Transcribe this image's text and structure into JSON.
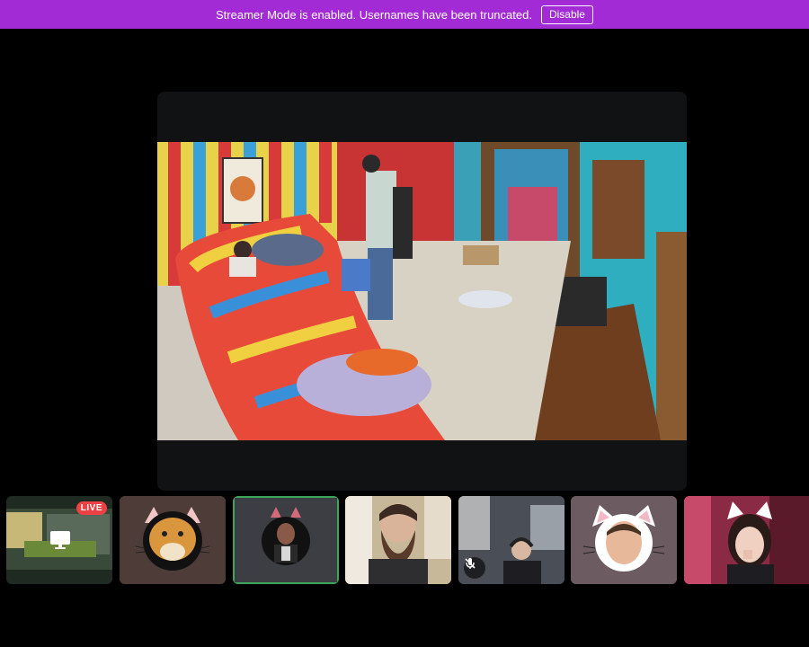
{
  "banner": {
    "message": "Streamer Mode is enabled. Usernames have been truncated.",
    "disable_label": "Disable",
    "bg_color": "#a32bd6"
  },
  "main_stream": {
    "type": "camera-feed",
    "frame_color": "#101214"
  },
  "participants": [
    {
      "kind": "screen-share",
      "badge": "LIVE",
      "badge_color": "#ed4245",
      "icon": "screen-share-icon"
    },
    {
      "kind": "camera",
      "filter": "dog-ears"
    },
    {
      "kind": "camera",
      "active": true,
      "highlight_color": "#3ba55c"
    },
    {
      "kind": "camera"
    },
    {
      "kind": "camera",
      "muted": true,
      "icon": "mic-muted-icon"
    },
    {
      "kind": "camera",
      "filter": "cat-ears"
    },
    {
      "kind": "camera",
      "filter": "cat-ears"
    }
  ]
}
